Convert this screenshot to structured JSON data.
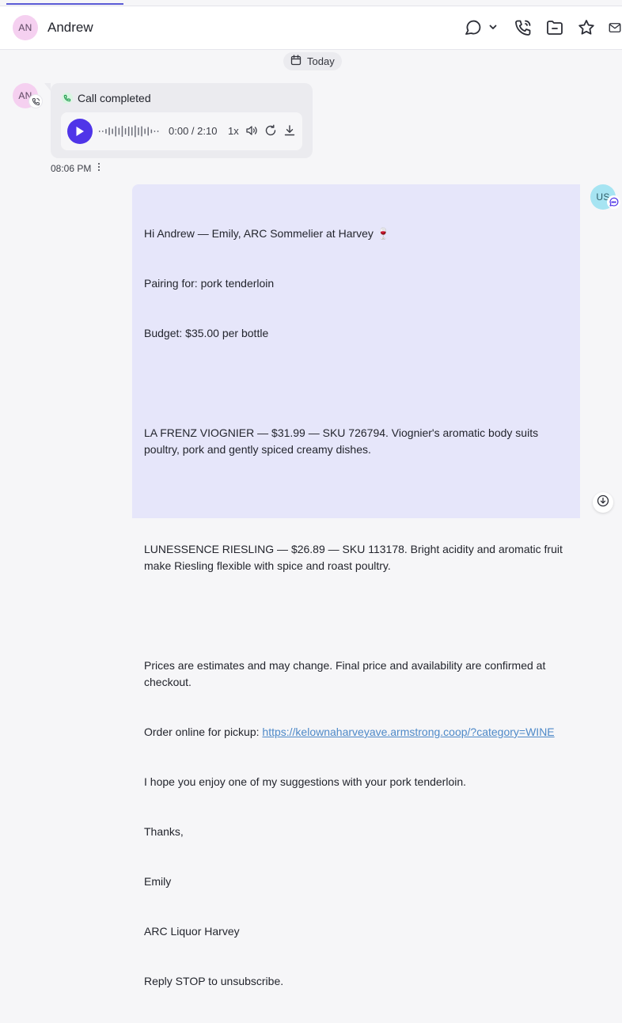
{
  "header": {
    "contact_initials": "AN",
    "contact_name": "Andrew",
    "icons": [
      "chat-bubble-icon",
      "chevron-down-icon",
      "phone-icon",
      "folder-icon",
      "star-icon",
      "mail-icon"
    ]
  },
  "date_divider": {
    "label": "Today",
    "icon": "calendar-icon"
  },
  "call_message": {
    "avatar_initials": "AN",
    "status": "Call completed",
    "player": {
      "current_time": "0:00",
      "separator": " / ",
      "duration": "2:10",
      "speed": "1x",
      "progress": 0
    },
    "timestamp": "08:06 PM"
  },
  "outgoing_message": {
    "avatar_initials": "US",
    "lines": [
      "Hi Andrew — Emily, ARC Sommelier at Harvey 🍷",
      "Pairing for: pork tenderloin",
      "Budget: $35.00 per bottle",
      "",
      "LA FRENZ VIOGNIER — $31.99 — SKU 726794. Viognier's aromatic body suits poultry, pork and gently spiced creamy dishes.",
      "",
      "LUNESSENCE RIESLING — $26.89 — SKU 113178. Bright acidity and aromatic fruit make Riesling flexible with spice and roast poultry.",
      "",
      "Prices are estimates and may change. Final price and availability are confirmed at checkout."
    ],
    "link_prefix": "Order online for pickup: ",
    "link_text": "https://kelownaharveyave.armstrong.coop/?category=WINE",
    "closing_lines": [
      "I hope you enjoy one of my suggestions with your pork tenderloin.",
      "Thanks,",
      "Emily",
      "ARC Liquor Harvey",
      "Reply STOP to unsubscribe."
    ]
  },
  "colors": {
    "accent": "#4f35e8",
    "tab_indicator": "#5b5bd6",
    "outgoing_bubble": "#e6e6fa",
    "incoming_bubble": "#ebebef",
    "link": "#4e89c8",
    "avatar_pink": "#f5d0f0",
    "avatar_cyan": "#a6e4f2"
  }
}
